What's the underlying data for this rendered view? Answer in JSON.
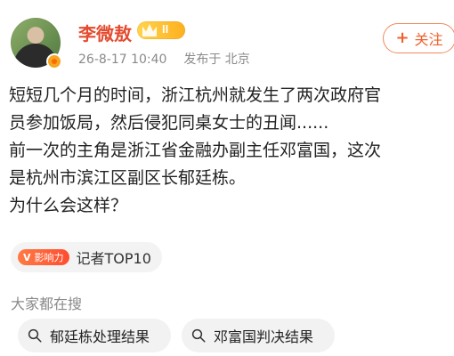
{
  "header": {
    "username": "李微敖",
    "level_badge": "II",
    "timestamp": "26-8-17 10:40",
    "publish_prefix": "发布于",
    "location": "北京",
    "follow_label": "关注"
  },
  "post": {
    "text": "短短几个月的时间，浙江杭州就发生了两次政府官\n员参加饭局，然后侵犯同桌女士的丑闻......\n前一次的主角是浙江省金融办副主任邓富国，这次\n是杭州市滨江区副区长郁廷栋。\n为什么会这样？"
  },
  "tag": {
    "badge_text": "影响力",
    "label": "记者TOP10"
  },
  "search": {
    "section_title": "大家都在搜",
    "chips": [
      "郁廷栋处理结果",
      "邓富国判决结果"
    ]
  },
  "colors": {
    "accent": "#f0602c",
    "name": "#e34b2f",
    "muted": "#8a8a8a"
  }
}
